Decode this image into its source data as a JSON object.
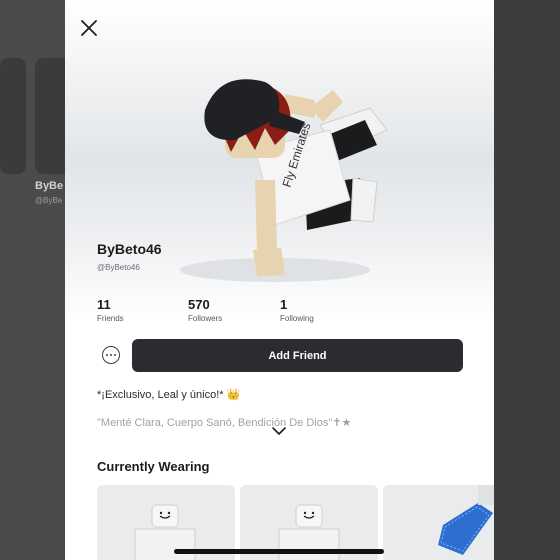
{
  "background": {
    "partial_name": "ByBe",
    "partial_handle": "@ByBe"
  },
  "profile": {
    "display_name": "ByBeto46",
    "handle": "@ByBeto46",
    "stats": [
      {
        "value": "11",
        "label": "Friends"
      },
      {
        "value": "570",
        "label": "Followers"
      },
      {
        "value": "1",
        "label": "Following"
      }
    ],
    "add_friend_label": "Add Friend",
    "bio_line1": "*¡Exclusivo, Leal y único!* 👑",
    "bio_line2": "\"Menté Clara, Cuerpo Sanó, Bendición De Dios\"✝★"
  },
  "wearing": {
    "title": "Currently Wearing",
    "items": [
      "item-1",
      "item-2",
      "item-3"
    ]
  },
  "icons": {
    "close": "close-icon",
    "more": "more-options-icon",
    "expand": "chevron-down-icon"
  },
  "colors": {
    "button_bg": "#2a2c30",
    "overlay": "#3a3b3d",
    "cap": "#1f2124",
    "hair": "#8a1e14",
    "skin": "#e8d3b0"
  }
}
